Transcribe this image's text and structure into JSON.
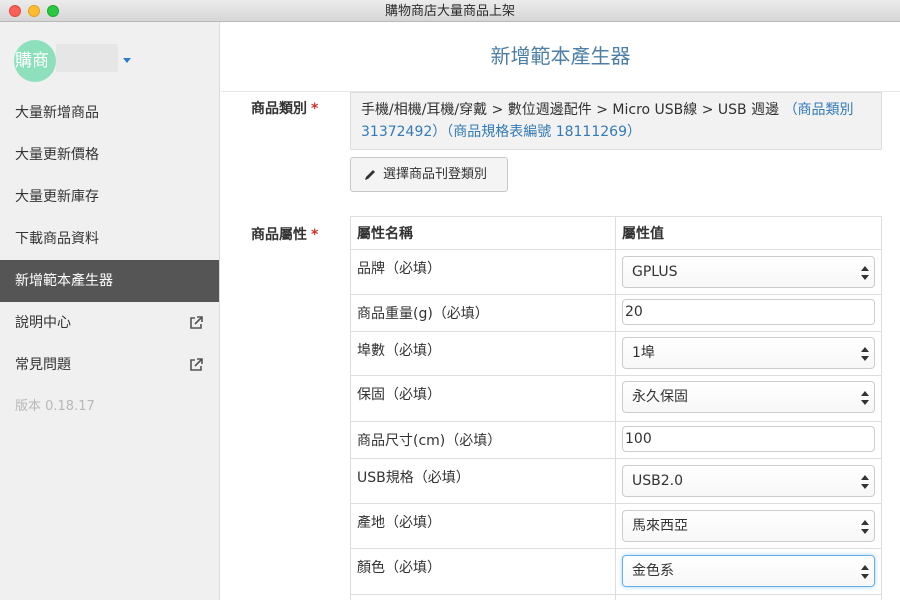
{
  "window": {
    "title": "購物商店大量商品上架"
  },
  "sidebar": {
    "avatar_text": "購商",
    "items": [
      {
        "label": "大量新增商品",
        "active": false,
        "external": false
      },
      {
        "label": "大量更新價格",
        "active": false,
        "external": false
      },
      {
        "label": "大量更新庫存",
        "active": false,
        "external": false
      },
      {
        "label": "下載商品資料",
        "active": false,
        "external": false
      },
      {
        "label": "新增範本產生器",
        "active": true,
        "external": false
      },
      {
        "label": "說明中心",
        "active": false,
        "external": true
      },
      {
        "label": "常見問題",
        "active": false,
        "external": true
      }
    ],
    "version": "版本 0.18.17"
  },
  "main": {
    "header_title": "新增範本產生器",
    "category": {
      "label": "商品類別",
      "required_mark": "*",
      "path": "手機/相機/耳機/穿戴 > 數位週邊配件 > Micro USB線 > USB 週邊",
      "category_link": "（商品類別 31372492）",
      "spec_link": "（商品規格表編號 18111269）",
      "choose_button": "選擇商品刊登類別"
    },
    "attributes": {
      "label": "商品屬性",
      "required_mark": "*",
      "col_name": "屬性名稱",
      "col_value": "屬性值",
      "rows": [
        {
          "name": "品牌（必填）",
          "type": "select",
          "value": "GPLUS"
        },
        {
          "name": "商品重量(g)（必填）",
          "type": "input",
          "value": "20"
        },
        {
          "name": "埠數（必填）",
          "type": "select",
          "value": "1埠"
        },
        {
          "name": "保固（必填）",
          "type": "select",
          "value": "永久保固"
        },
        {
          "name": "商品尺寸(cm)（必填）",
          "type": "input",
          "value": "100"
        },
        {
          "name": "USB規格（必填）",
          "type": "select",
          "value": "USB2.0"
        },
        {
          "name": "產地（必填）",
          "type": "select",
          "value": "馬來西亞"
        },
        {
          "name": "顏色（必填）",
          "type": "select",
          "value": "金色系"
        }
      ]
    }
  },
  "colors": {
    "accent": "#337ab7",
    "header_text": "#4d7fa6",
    "sidebar_active": "#555555",
    "required": "#c9302c"
  }
}
